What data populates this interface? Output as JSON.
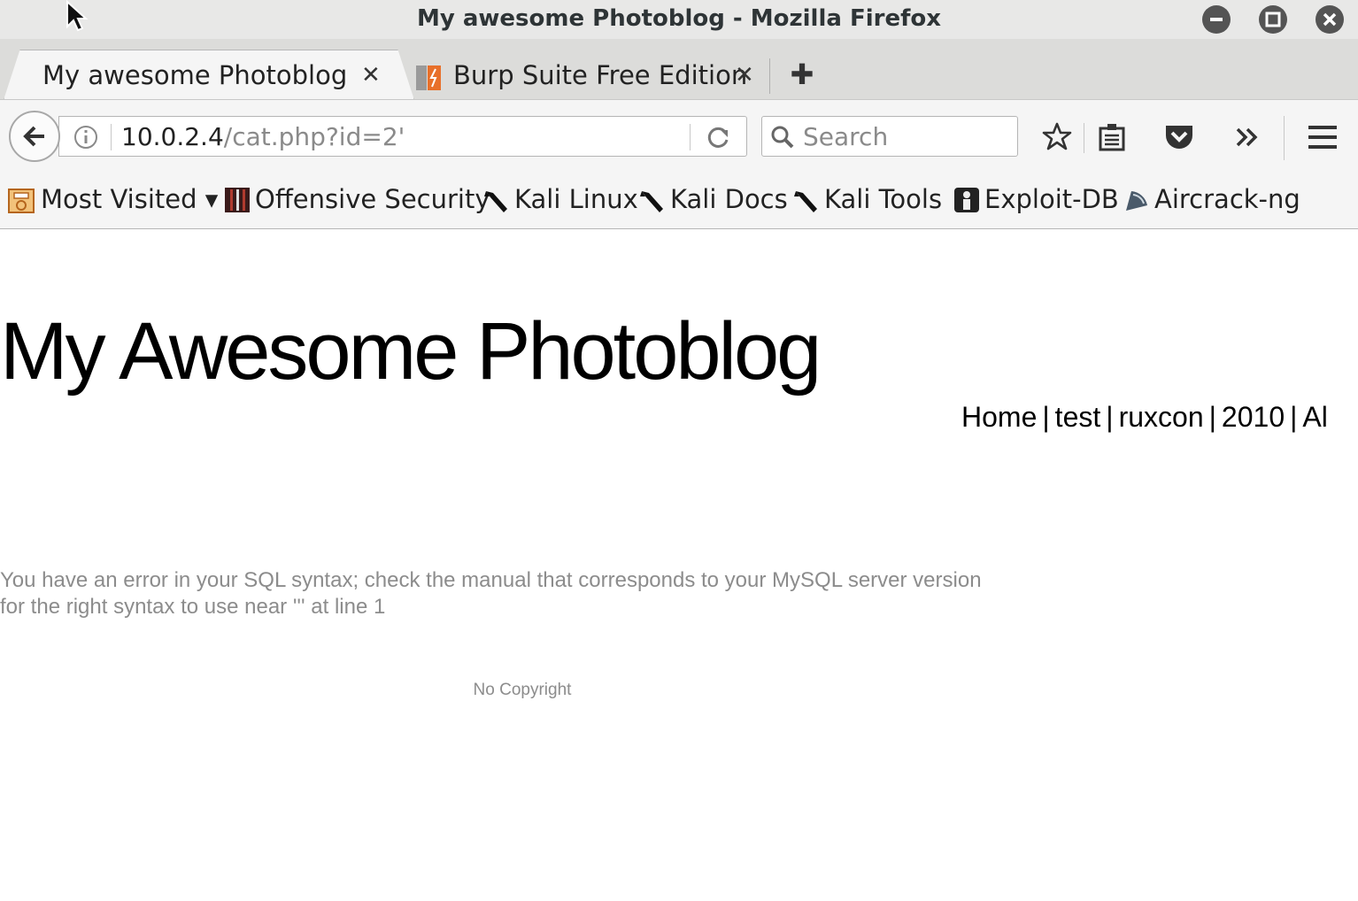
{
  "window": {
    "title": "My awesome Photoblog - Mozilla Firefox"
  },
  "tabs": [
    {
      "label": "My awesome Photoblog",
      "active": true
    },
    {
      "label": "Burp Suite Free Edition",
      "active": false
    }
  ],
  "navbar": {
    "url_host": "10.0.2.4",
    "url_path": "/cat.php?id=2'",
    "search_placeholder": "Search"
  },
  "bookmarks": [
    {
      "label": "Most Visited ▾",
      "icon": "most-visited-icon"
    },
    {
      "label": "Offensive Security",
      "icon": "offensive-security-icon"
    },
    {
      "label": "Kali Linux",
      "icon": "kali-dragon-icon"
    },
    {
      "label": "Kali Docs",
      "icon": "kali-dragon-icon"
    },
    {
      "label": "Kali Tools",
      "icon": "kali-dragon-icon"
    },
    {
      "label": "Exploit-DB",
      "icon": "exploit-db-icon"
    },
    {
      "label": "Aircrack-ng",
      "icon": "aircrack-icon"
    }
  ],
  "page": {
    "site_title": "My Awesome Photoblog",
    "nav": [
      "Home",
      "test",
      "ruxcon",
      "2010",
      "Al"
    ],
    "nav_separator": "|",
    "error_message": "You have an error in your SQL syntax; check the manual that corresponds to your MySQL server version for the right syntax to use near ''' at line 1",
    "footer": "No Copyright"
  },
  "colors": {
    "titlebar": "#e8e8e7",
    "toolbar": "#f5f5f5",
    "muted_text": "#8c8c8c",
    "burp_orange": "#e8702a"
  }
}
